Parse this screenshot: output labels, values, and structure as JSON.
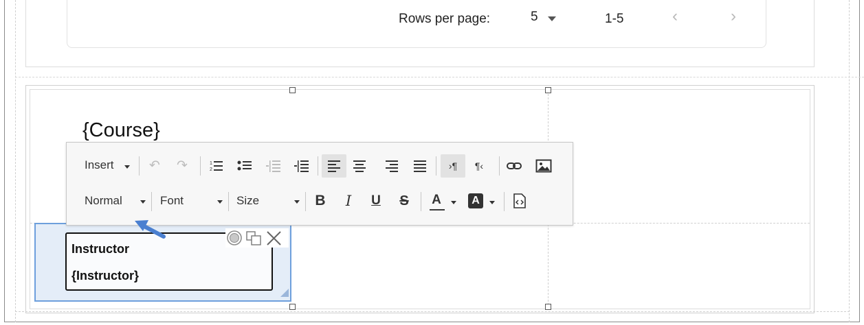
{
  "pagination": {
    "rows_per_page_label": "Rows per page:",
    "rows_per_page_value": "5",
    "page_range": "1-5",
    "prev_icon": "chevron-left-icon",
    "next_icon": "chevron-right-icon"
  },
  "canvas": {
    "course_placeholder": "{Course}"
  },
  "toolbar": {
    "insert_label": "Insert",
    "format_label": "Normal",
    "font_label": "Font",
    "size_label": "Size",
    "bold_label": "B",
    "italic_label": "I",
    "underline_label": "U",
    "strike_label": "S",
    "text_color_label": "A",
    "bg_color_label": "A",
    "icons": [
      "undo-icon",
      "redo-icon",
      "numbered-list-icon",
      "bulleted-list-icon",
      "decrease-indent-icon",
      "increase-indent-icon",
      "align-left-icon",
      "align-center-icon",
      "align-right-icon",
      "justify-icon",
      "ltr-icon",
      "rtl-icon",
      "link-icon",
      "image-icon",
      "source-icon"
    ]
  },
  "selected_widget": {
    "label": "Instructor",
    "value": "{Instructor}",
    "actions": [
      "settings-icon",
      "duplicate-icon",
      "close-icon"
    ]
  },
  "colors": {
    "selection_border": "#6d9fdc",
    "selection_fill": "#e4edf8",
    "arrow": "#4a7fd0"
  }
}
